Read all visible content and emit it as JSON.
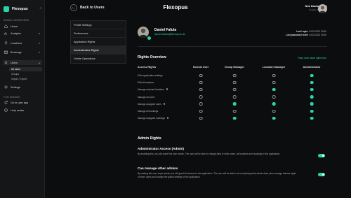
{
  "sidebar": {
    "brand": "Flexopus",
    "section_admin": "ADMIN DASHBOARD",
    "nav": [
      {
        "label": "Home",
        "icon": "home-icon"
      },
      {
        "label": "Analytics",
        "icon": "analytics-icon"
      },
      {
        "label": "Locations",
        "icon": "locations-icon"
      },
      {
        "label": "Bookings",
        "icon": "bookings-icon"
      },
      {
        "label": "Users",
        "icon": "users-icon"
      }
    ],
    "users_sub": [
      "All users",
      "Groups",
      "Import / Export"
    ],
    "settings_label": "Settings",
    "section_user": "FOR ADMINS",
    "bottom": [
      {
        "label": "Go to user app",
        "icon": "external-link-icon"
      },
      {
        "label": "Help center",
        "icon": "help-icon"
      }
    ]
  },
  "header": {
    "back_label": "Back to Users",
    "title": "Flexopus",
    "user_name": "New Dasha, Bryan",
    "user_role": "Creator, All Owners"
  },
  "menu": [
    "Profile Settings",
    "Preferences",
    "Application Rights",
    "Administrative Rights",
    "Delete Operations"
  ],
  "profile": {
    "name": "Daniel Fafula",
    "email": "daniel.fafula@flexopus.de",
    "last_login_label": "Last Login:",
    "last_login": "24.02.2021 20:54",
    "last_pw_label": "Last password reset:",
    "last_pw": "24.02.2021 20:54"
  },
  "rights": {
    "title": "Rights Overview",
    "link": "Read more about rights here",
    "columns": [
      "Access Rights",
      "Normal User",
      "Group Manager",
      "Location Manager",
      "Administrator"
    ],
    "rows": [
      {
        "label": "Edit organization settings",
        "info": false,
        "values": [
          0,
          0,
          0,
          1
        ]
      },
      {
        "label": "Edit all locations",
        "info": false,
        "values": [
          0,
          0,
          0,
          1
        ]
      },
      {
        "label": "Manage selected locations",
        "info": true,
        "values": [
          0,
          0,
          1,
          1
        ]
      },
      {
        "label": "Manage all users",
        "info": false,
        "values": [
          0,
          0,
          0,
          1
        ]
      },
      {
        "label": "Manage assigned users",
        "info": true,
        "values": [
          0,
          1,
          1,
          1
        ]
      },
      {
        "label": "Manage all bookings",
        "info": false,
        "values": [
          0,
          0,
          0,
          1
        ]
      },
      {
        "label": "Manage assigned bookings",
        "info": true,
        "values": [
          0,
          1,
          1,
          1
        ]
      }
    ]
  },
  "admin": {
    "title": "Admin Rights",
    "options": [
      {
        "title": "Administrator Access (Admin)",
        "desc": "By enabling this, you will make this user admin. The user will be able to change data of other users, all locations and bookings in the application.",
        "enabled": true
      },
      {
        "title": "Can manage other admins",
        "desc": "By making this user super admin you will grant full access to the application. The user will be able to do everything what admin does, plus manage admins rights of other users and change the global settings of the application.",
        "enabled": true
      }
    ]
  },
  "colors": {
    "accent": "#2ad4a8",
    "background": "#0c0d0e",
    "sidebar": "#151617"
  }
}
